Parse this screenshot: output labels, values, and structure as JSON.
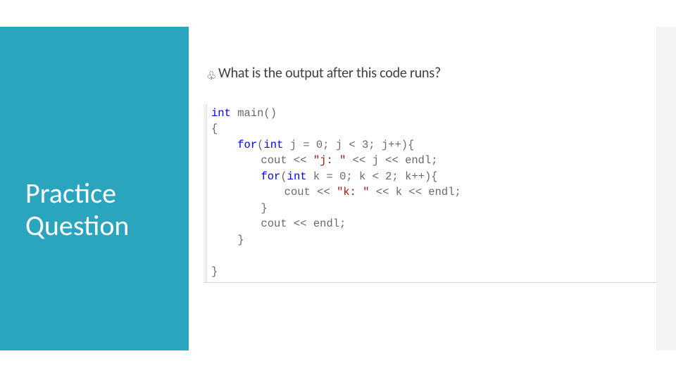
{
  "title_line1": "Practice",
  "title_line2": "Question",
  "question": "What is the output after this code runs?",
  "bullet_icon": "♧",
  "code": {
    "l1_a": "int",
    "l1_b": " main()",
    "l2": "{",
    "l3_a": "    ",
    "l3_b": "for",
    "l3_c": "(",
    "l3_d": "int",
    "l3_e": " j = 0; j < 3; j++){",
    "l4_a": "    ",
    "l4_b": "    cout << ",
    "l4_c": "\"j: \"",
    "l4_d": " << j << endl;",
    "l5_a": "    ",
    "l5_b": "    ",
    "l5_c": "for",
    "l5_d": "(",
    "l5_e": "int",
    "l5_f": " k = 0; k < 2; k++){",
    "l6_a": "    ",
    "l6_b": "    ",
    "l6_c": "    cout << ",
    "l6_d": "\"k: \"",
    "l6_e": " << k << endl;",
    "l7_a": "    ",
    "l7_b": "    }",
    "l8_a": "    ",
    "l8_b": "    cout << endl;",
    "l9_a": "    ",
    "l9_b": "}",
    "l10": "",
    "l11": "}"
  }
}
